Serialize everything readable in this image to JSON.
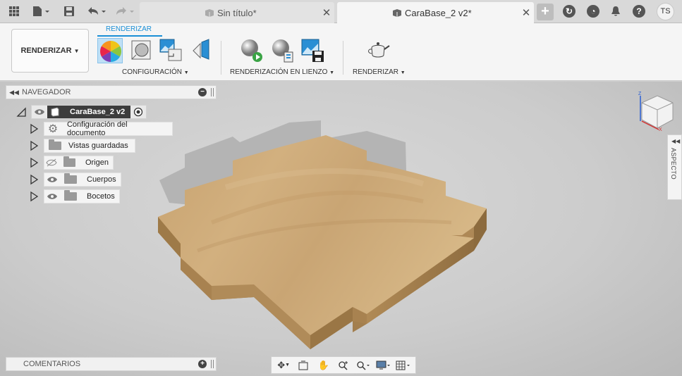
{
  "tabs": {
    "inactive": {
      "label": "Sin título*"
    },
    "active": {
      "label": "CaraBase_2 v2*"
    }
  },
  "user": {
    "initials": "TS"
  },
  "ribbon": {
    "workspace_label": "RENDERIZAR",
    "active_tab": "RENDERIZAR",
    "groups": {
      "setup": "CONFIGURACIÓN",
      "in_canvas": "RENDERIZACIÓN EN LIENZO",
      "render": "RENDERIZAR"
    }
  },
  "browser": {
    "title": "NAVEGADOR",
    "root": "CaraBase_2 v2",
    "items": [
      {
        "label": "Configuración del documento"
      },
      {
        "label": "Vistas guardadas"
      },
      {
        "label": "Origen"
      },
      {
        "label": "Cuerpos"
      },
      {
        "label": "Bocetos"
      }
    ]
  },
  "aspect_label": "ASPECTO",
  "comments_label": "COMENTARIOS",
  "colors": {
    "accent": "#1a8fd6",
    "wood": "#c9a472",
    "background": "#cccccc"
  }
}
